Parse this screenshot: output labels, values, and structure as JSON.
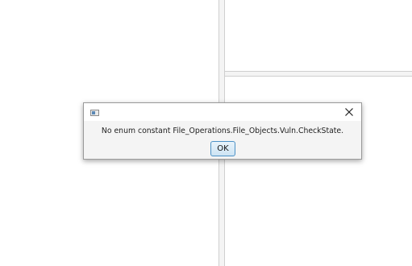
{
  "dialog": {
    "message": "No enum constant File_Operations.File_Objects.Vuln.CheckState.",
    "ok_label": "OK",
    "close_symbol": "×",
    "app_icon": "java-app-icon",
    "close_icon": "close-icon"
  },
  "colors": {
    "button_border": "#4d92c6",
    "button_fill": "#cde4f4",
    "dialog_bg": "#f4f4f4"
  }
}
